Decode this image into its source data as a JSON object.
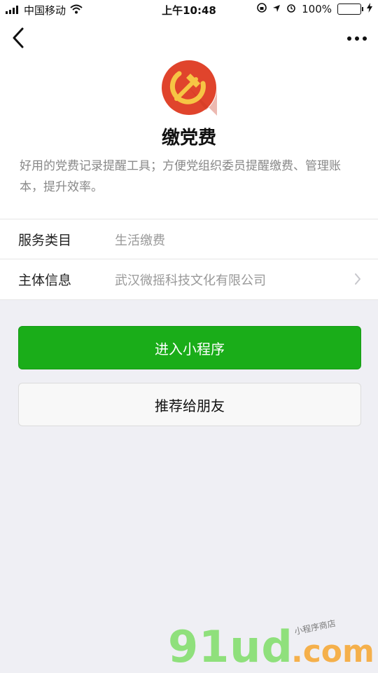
{
  "status_bar": {
    "carrier": "中国移动",
    "time": "上午10:48",
    "battery_percent": "100%",
    "battery_level": 1.0
  },
  "nav": {
    "back_icon": "chevron-left-icon",
    "more_icon": "more-dots-icon"
  },
  "app": {
    "name": "缴党费",
    "description": "好用的党费记录提醒工具；方便党组织委员提醒缴费、管理账本，提升效率。",
    "logo": "party-emblem-logo"
  },
  "info": {
    "service_label": "服务类目",
    "service_value": "生活缴费",
    "entity_label": "主体信息",
    "entity_value": "武汉微摇科技文化有限公司"
  },
  "buttons": {
    "enter": "进入小程序",
    "share": "推荐给朋友"
  },
  "watermark": {
    "brand": "91ud",
    "tld": ".com",
    "caption": "小程序商店"
  },
  "colors": {
    "primary_green": "#1aad19",
    "background": "#efeff4",
    "logo_red": "#e0442c",
    "emblem_gold": "#f6c544"
  }
}
